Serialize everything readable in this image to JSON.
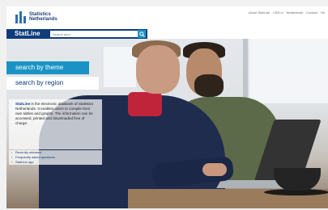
{
  "header": {
    "logo_line1": "Statistics",
    "logo_line2": "Netherlands",
    "util_nav": [
      "About StatLine",
      "CBS.nl",
      "Nederlands",
      "Contact",
      "He"
    ]
  },
  "statline": {
    "title": "StatLine",
    "search_placeholder": "Search term",
    "search_icon": "search-icon"
  },
  "nav": {
    "search_by_theme": "search by theme",
    "search_by_region": "search by region"
  },
  "info": {
    "brand": "StatLine",
    "description": "is the electronic databank of Statistics Netherlands. It enables users to compile their own tables and graphs. The information can be accessed, printed and downloaded free of charge."
  },
  "links": [
    "Recently released",
    "Frequently asked questions",
    "StatLine app"
  ],
  "colors": {
    "navy": "#0f3c7a",
    "accent": "#1a93c4"
  }
}
